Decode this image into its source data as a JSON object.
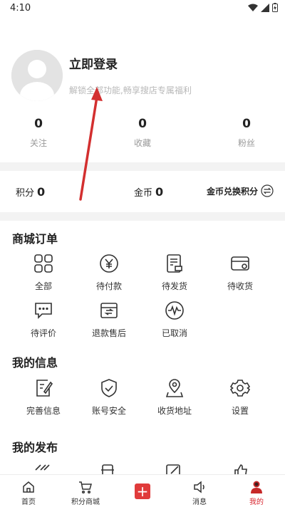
{
  "status_bar": {
    "time": "4:10"
  },
  "profile": {
    "login_title": "立即登录",
    "login_subtitle": "解锁全部功能,畅享搜店专属福利",
    "stats": [
      {
        "value": "0",
        "label": "关注"
      },
      {
        "value": "0",
        "label": "收藏"
      },
      {
        "value": "0",
        "label": "粉丝"
      }
    ]
  },
  "coins": {
    "points_label": "积分",
    "points_value": "0",
    "gold_label": "金币",
    "gold_value": "0",
    "exchange_label": "金币兑换积分"
  },
  "orders": {
    "title": "商城订单",
    "items": [
      {
        "label": "全部",
        "icon": "grid-icon"
      },
      {
        "label": "待付款",
        "icon": "yen-icon"
      },
      {
        "label": "待发货",
        "icon": "document-icon"
      },
      {
        "label": "待收货",
        "icon": "box-icon"
      },
      {
        "label": "待评价",
        "icon": "comment-icon"
      },
      {
        "label": "退款售后",
        "icon": "refund-icon"
      },
      {
        "label": "已取消",
        "icon": "pulse-icon"
      }
    ]
  },
  "info": {
    "title": "我的信息",
    "items": [
      {
        "label": "完善信息",
        "icon": "edit-icon"
      },
      {
        "label": "账号安全",
        "icon": "shield-icon"
      },
      {
        "label": "收货地址",
        "icon": "location-icon"
      },
      {
        "label": "设置",
        "icon": "gear-icon"
      }
    ]
  },
  "publish": {
    "title": "我的发布"
  },
  "tabbar": {
    "items": [
      {
        "label": "首页",
        "icon": "home-icon"
      },
      {
        "label": "积分商城",
        "icon": "cart-icon"
      },
      {
        "label": "",
        "icon": "plus-icon"
      },
      {
        "label": "消息",
        "icon": "speaker-icon"
      },
      {
        "label": "我的",
        "icon": "user-icon"
      }
    ],
    "active_index": 4
  },
  "colors": {
    "accent": "#d8262f",
    "plus_button": "#e03b3b",
    "divider": "#f3f3f3"
  }
}
